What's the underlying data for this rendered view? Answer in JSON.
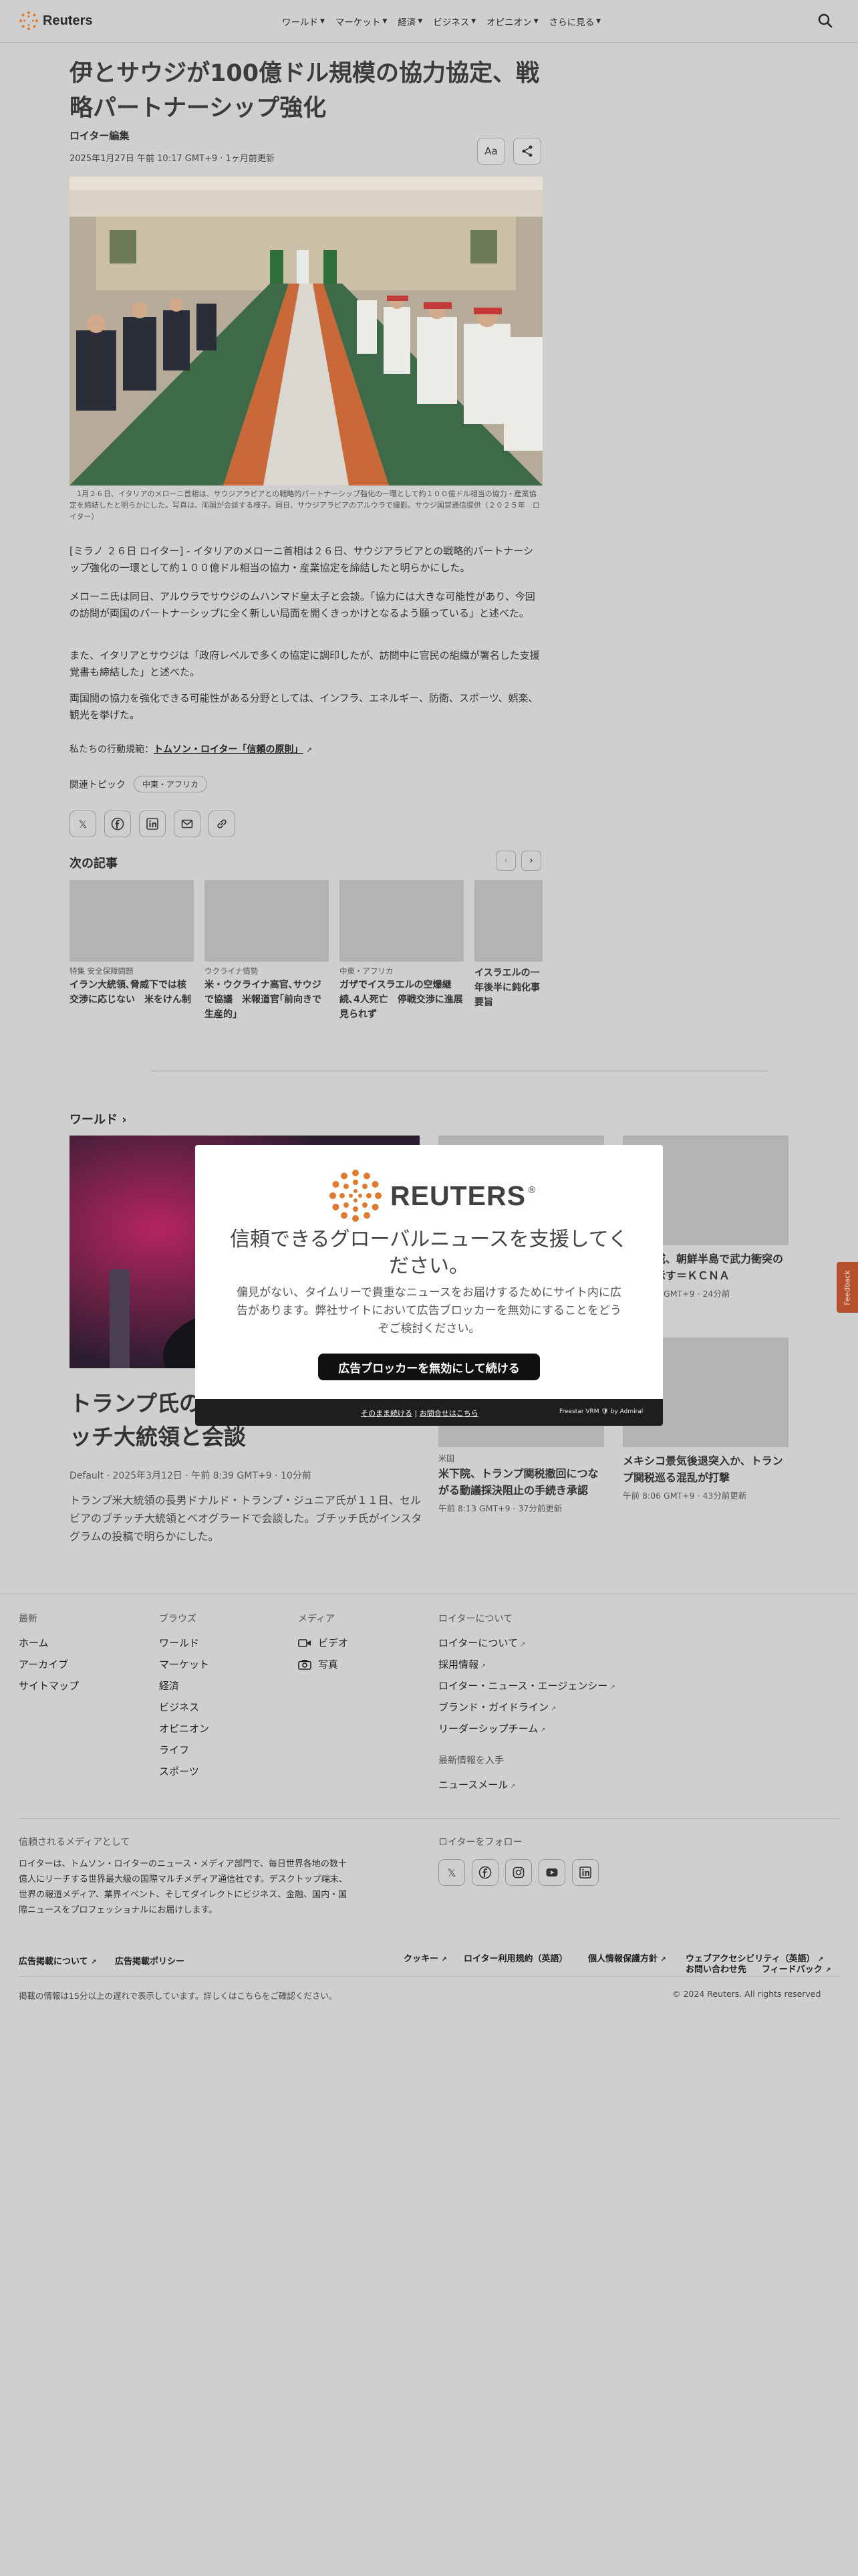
{
  "header": {
    "logo": "Reuters",
    "nav": [
      "ワールド",
      "マーケット",
      "経済",
      "ビジネス",
      "オピニオン",
      "さらに見る"
    ]
  },
  "article": {
    "headline": "伊とサウジが100億ドル規模の協力協定、戦略パートナーシップ強化",
    "byline": "ロイター編集",
    "dateline": "2025年1月27日 午前 10:17 GMT+9 · 1ヶ月前更新",
    "text_size_button": "Aa",
    "caption": "　1月２６日、イタリアのメローニ首相は、サウジアラビアとの戦略的パートナーシップ強化の一環として約１００億ドル相当の協力・産業協定を締結したと明らかにした。写真は、両国が会談する様子。同日、サウジアラビアのアルウラで撮影。サウジ国営通信提供（２０２５年　ロイター）",
    "paragraphs": [
      "[ミラノ ２６日 ロイター] - イタリアのメローニ首相は２６日、サウジアラビアとの戦略的パートナーシップ強化の一環として約１００億ドル相当の協力・産業協定を締結したと明らかにした。",
      "メローニ氏は同日、アルウラでサウジのムハンマド皇太子と会談。「協力には大きな可能性があり、今回の訪問が両国のパートナーシップに全く新しい局面を開くきっかけとなるよう願っている」と述べた。",
      "また、イタリアとサウジは「政府レベルで多くの協定に調印したが、訪問中に官民の組織が署名した支援覚書も締結した」と述べた。",
      "両国間の協力を強化できる可能性がある分野としては、インフラ、エネルギー、防衛、スポーツ、娯楽、観光を挙げた。"
    ],
    "principles_prefix": "私たちの行動規範：",
    "principles_link": "トムソン・ロイター「信頼の原則」",
    "topics_label": "関連トピック",
    "topic_chip": "中東・アフリカ"
  },
  "next_articles": {
    "title": "次の記事",
    "cards": [
      {
        "tag": "特集 安全保障問題",
        "title": "イラン大統領､脅威下では核交渉に応じない　米をけん制"
      },
      {
        "tag": "ウクライナ情勢",
        "title": "米・ウクライナ高官､サウジで協議　米報道官｢前向きで生産的｣"
      },
      {
        "tag": "中東・アフリカ",
        "title": "ガザでイスラエルの空爆継続､4人死亡　停戦交渉に進展見られず"
      },
      {
        "tag": "",
        "title": "イスラエルの一年後半に鈍化事要旨"
      }
    ]
  },
  "world_section": {
    "title": "ワールド",
    "lead": {
      "title": "トランプ氏の長男、セルビアでブチッチ大統領と会談",
      "meta": "Default · 2025年3月12日 · 午前 8:39 GMT+9 · 10分前",
      "desc": "トランプ米大統領の長男ドナルド・トランプ・ジュニア氏が１１日、セルビアのブチッチ大統領とベオグラードで会談した。ブチッチ氏がインスタグラムの投稿で明らかにした。"
    },
    "side": [
      {
        "tag": "",
        "title": "米の脅威、朝鮮半島で武力衝突の可能性示す＝ＫＣＮＡ",
        "time": "午前 8:15 GMT+9 · 24分前"
      },
      {
        "tag": "米国",
        "title": "米下院、トランプ関税撤回につながる動議採決阻止の手続き承認",
        "time": "午前 8:13 GMT+9 · 37分前更新"
      },
      {
        "tag": "",
        "title": "メキシコ景気後退突入か、トランプ関税巡る混乱が打撃",
        "time": "午前 8:06 GMT+9 · 43分前更新"
      }
    ]
  },
  "feedback_label": "Feedback",
  "footer": {
    "col1": {
      "heading": "最新",
      "links": [
        "ホーム",
        "アーカイブ",
        "サイトマップ"
      ]
    },
    "col2": {
      "heading": "ブラウズ",
      "links": [
        "ワールド",
        "マーケット",
        "経済",
        "ビジネス",
        "オピニオン",
        "ライフ",
        "スポーツ"
      ]
    },
    "col3": {
      "heading": "メディア",
      "links": [
        "ビデオ",
        "写真"
      ]
    },
    "col4": {
      "heading": "ロイターについて",
      "links": [
        "ロイターについて",
        "採用情報",
        "ロイター・ニュース・エージェンシー",
        "ブランド・ガイドライン",
        "リーダーシップチーム"
      ]
    },
    "col5": {
      "heading": "最新情報を入手",
      "links": [
        "ニュースメール"
      ]
    },
    "trusted_heading": "信頼されるメディアとして",
    "trusted_text": "ロイターは、トムソン・ロイターのニュース・メディア部門で、毎日世界各地の数十億人にリーチする世界最大級の国際マルチメディア通信社です。デスクトップ端末、世界の報道メディア、業界イベント、そしてダイレクトにビジネス、金融、国内・国際ニュースをプロフェッショナルにお届けします。",
    "follow_heading": "ロイターをフォロー",
    "bottom_links": [
      "広告掲載について",
      "広告掲載ポリシー",
      "クッキー",
      "ロイター利用規約（英語）",
      "個人情報保護方針",
      "ウェブアクセシビリティ（英語）",
      "お問い合わせ先",
      "フィードバック"
    ],
    "delay_note": "掲載の情報は15分以上の遅れで表示しています。詳しくはこちらをご確認ください。",
    "copyright": "© 2024 Reuters. All rights reserved"
  },
  "modal": {
    "brand": "REUTERS",
    "title": "信頼できるグローバルニュースを支援してください。",
    "body": "偏見がない、タイムリーで貴重なニュースをお届けするためにサイト内に広告があります。弊社サイトにおいて広告ブロッカーを無効にすることをどうぞご検討ください。",
    "cta": "広告ブロッカーを無効にして続ける",
    "continue_link": "そのまま続ける",
    "help_link": "お問合せはこちら",
    "powered": "Freestar VRM 🛡 by Admiral"
  }
}
